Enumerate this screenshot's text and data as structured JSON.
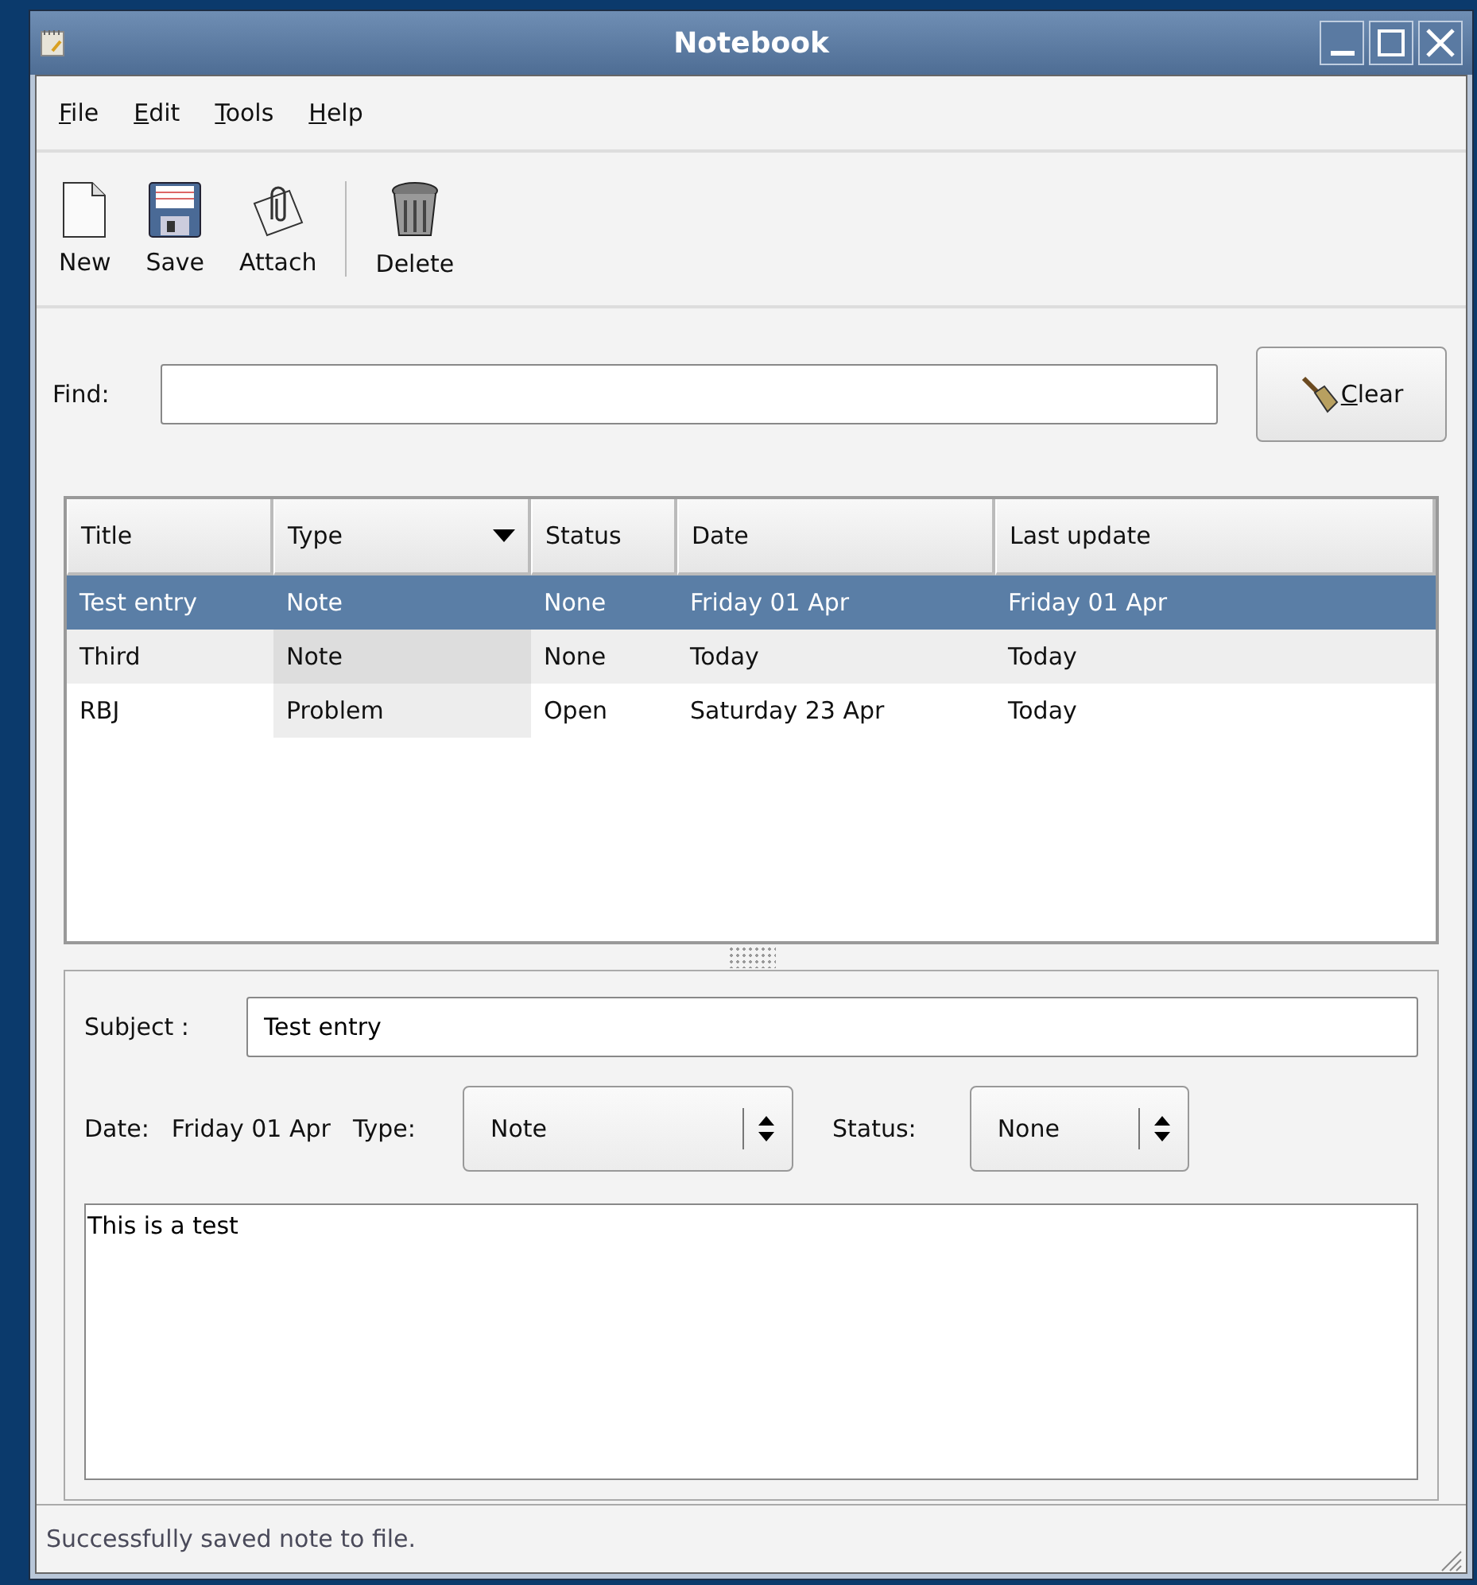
{
  "window": {
    "title": "Notebook"
  },
  "menu": [
    {
      "label": "File"
    },
    {
      "label": "Edit"
    },
    {
      "label": "Tools"
    },
    {
      "label": "Help"
    }
  ],
  "toolbar": [
    {
      "label": "New"
    },
    {
      "label": "Save"
    },
    {
      "label": "Attach"
    },
    {
      "label": "Delete"
    }
  ],
  "find": {
    "label": "Find:",
    "button": "Clear"
  },
  "table": {
    "columns": [
      {
        "label": "Title",
        "sorted": false
      },
      {
        "label": "Type",
        "sorted": true
      },
      {
        "label": "Status",
        "sorted": false
      },
      {
        "label": "Date",
        "sorted": false
      },
      {
        "label": "Last update",
        "sorted": false
      }
    ],
    "rows": [
      {
        "selected": true,
        "cells": [
          "Test entry",
          "Note",
          "None",
          "Friday 01 Apr",
          "Friday 01 Apr"
        ]
      },
      {
        "selected": false,
        "cells": [
          "Third",
          "Note",
          "None",
          "Today",
          "Today"
        ]
      },
      {
        "selected": false,
        "cells": [
          "RBJ",
          "Problem",
          "Open",
          "Saturday 23 Apr",
          "Today"
        ]
      }
    ]
  },
  "detail": {
    "subject_label": "Subject :",
    "subject": "Test entry",
    "date_label": "Date:",
    "date": "Friday 01 Apr",
    "type_label": "Type:",
    "type": "Note",
    "status_label": "Status:",
    "status": "None",
    "body": "This is a test"
  },
  "status_bar": "Successfully saved note to file."
}
